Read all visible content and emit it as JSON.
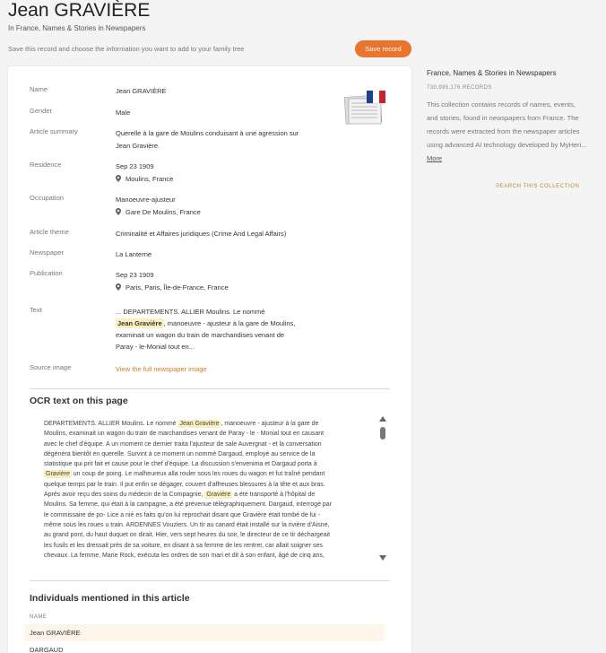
{
  "header": {
    "title": "Jean GRAVIÈRE",
    "subtitle": "In France, Names & Stories in Newspapers",
    "save_hint": "Save this record and choose the information you want to add to your family tree",
    "save_button": "Save record"
  },
  "record": {
    "name": {
      "label": "Name",
      "value": "Jean GRAVIÈRE"
    },
    "gender": {
      "label": "Gender",
      "value": "Male"
    },
    "summary": {
      "label": "Article summary",
      "line1": "Querelle à la gare de Moulins conduisant à une agression sur",
      "line2": "Jean Gravière."
    },
    "residence": {
      "label": "Residence",
      "date": "Sep 23 1909",
      "place": "Moulins, France"
    },
    "occupation": {
      "label": "Occupation",
      "value": "Manoeuvre-ajusteur",
      "place": "Gare De Moulins, France"
    },
    "theme": {
      "label": "Article theme",
      "value": "Criminalité et Affaires juridiques (Crime And Legal Affairs)"
    },
    "newspaper": {
      "label": "Newspaper",
      "value": "La Lanterne"
    },
    "publication": {
      "label": "Publication",
      "date": "Sep 23 1909",
      "place": "Paris, Paris, Île-de-France, France"
    },
    "text": {
      "label": "Text",
      "line1": "... DEPARTEMENTS. ALLIER Moulins. Le nommé",
      "highlight": "Jean Gravière",
      "line2_rest": ", manoeuvre - ajusteur à la gare de Moulins,",
      "line3": "examinait un wagon du train de marchandises venant de",
      "line4": "Paray - le-Monial tout en..."
    },
    "source": {
      "label": "Source image",
      "link": "View the full newspaper image"
    }
  },
  "ocr": {
    "title": "OCR text on this page",
    "l1_a": "DEPARTEMENTS. ALLIER Moulins. Le nommé ",
    "l1_hl": "Jean Gravière",
    "l1_b": ", manoeuvre - ajusteur à la gare de",
    "l2": "Moulins, examinait un wagon du train de marchandises venant de Paray - le - Monial tout en causant",
    "l3": "avec le chef d'équipe. A un moment ce dernier traita l'ajusteur de sale Auvergnat - et la conversation",
    "l4": "dégénéra bientôt en querelle. Survint à ce moment un nommé Dargaud, employé au service de la",
    "l5": "statistique qui prit fait et cause pour le chef d'équipe. La discussion s'envenima et Dargaud porta à",
    "l6_hl": "Gravière",
    "l6_b": " un coup de poing. Le malheureux alla rouler sous les roues du wagon et fut traîné pendant",
    "l7": "quelque temps par le train. Il put enfin se dégager, couvert d'affreuses blessures à la tête et aux bras.",
    "l8_a": "Après avoir reçu des soins du médecin de la Compagnie, ",
    "l8_hl": "Gravière",
    "l8_b": " a été transporté à l'hôpital de",
    "l9": "Moulins. Sa femme, qui était à la campagne, a été prévenue télégraphiquement. Dargaud, interrogé par",
    "l10": "le commissaire de po- Lice a nié es faits qu'on lui reprochait disant que Gravière était tombé de lui -",
    "l11": "même sous les roues u train. ARDENNES Vouziers. Un tir au canard était installé sur la rivière d'Aisne,",
    "l12": "au grand pont, du haut duquet on dirait. Hier, vers sept heures du soir, le directeur de ce tir déchargeait",
    "l13": "les fusils et les dressait près de sa voiture, en disant à sa femme de les rentrer, car allait soigner ses",
    "l14": "chevaux. La femme, Marie Rock, exécuta les ordres de son mari et dit à son enfant, âgé de cinq ans,"
  },
  "individuals": {
    "title": "Individuals mentioned in this article",
    "column": "NAME",
    "rows": [
      "Jean GRAVIÈRE",
      "DARGAUD"
    ]
  },
  "sidebar": {
    "title": "France, Names & Stories in Newspapers",
    "count": "730,995,176 RECORDS",
    "desc": "This collection contains records of names, events, and stories, found in newspapers from France. The records were extracted from the newspaper articles using advanced AI technology developed by MyHeri...",
    "more": "More",
    "search": "SEARCH THIS COLLECTION"
  },
  "colors": {
    "accent": "#e8742e",
    "highlight": "#faf0bf",
    "link": "#c9802b"
  }
}
